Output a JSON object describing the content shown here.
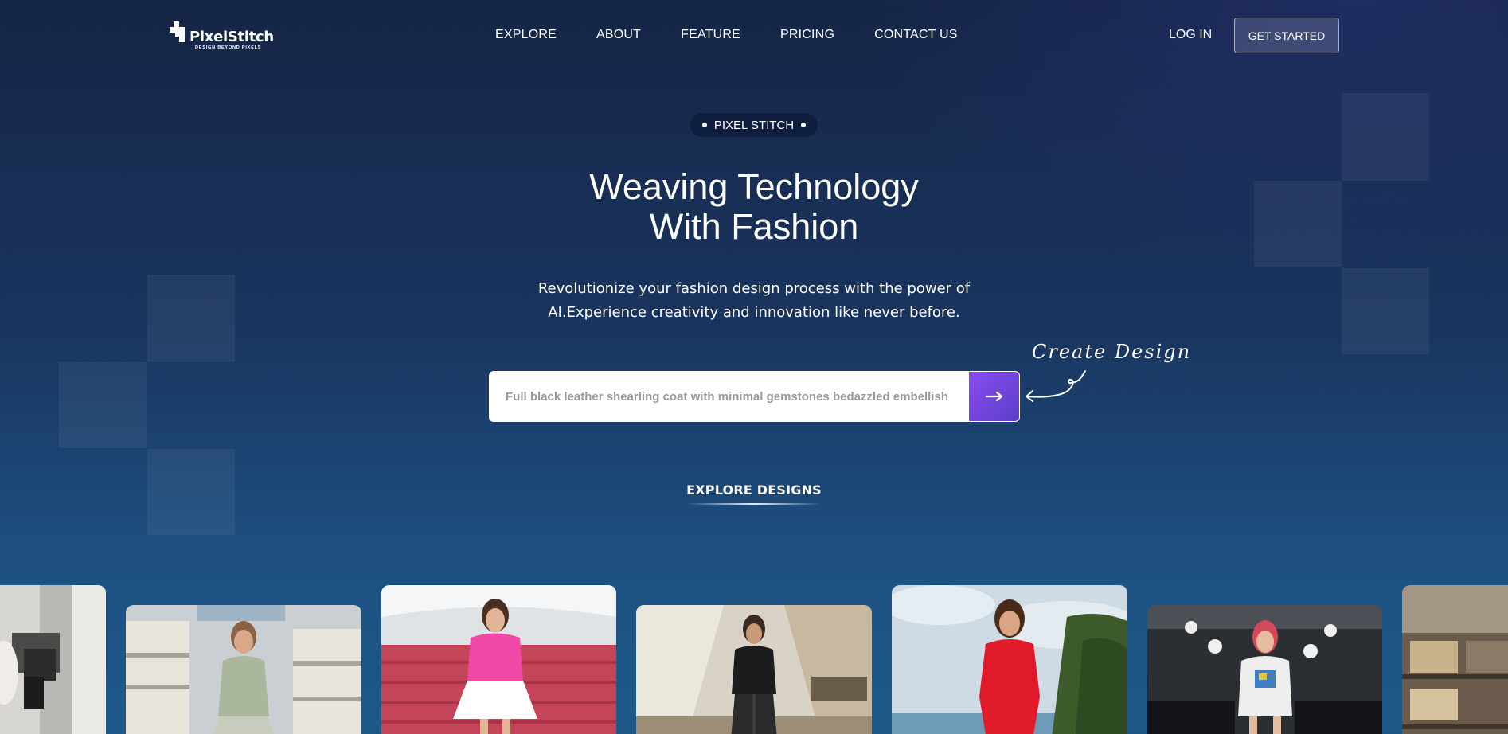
{
  "brand": {
    "name": "PixelStitch",
    "tagline": "DESIGN BEYOND PIXELS"
  },
  "nav": {
    "links": [
      "EXPLORE",
      "ABOUT",
      "FEATURE",
      "PRICING",
      "CONTACT US"
    ],
    "login": "LOG IN",
    "get_started": "GET STARTED"
  },
  "hero": {
    "badge": "PIXEL STITCH",
    "title_line1": "Weaving Technology",
    "title_line2": "With Fashion",
    "subtitle_line1": "Revolutionize your fashion design process with the power of",
    "subtitle_line2": "AI.Experience creativity and innovation like never before.",
    "search_placeholder": "Full black leather shearling coat with minimal gemstones bedazzled embellish",
    "submit_icon": "arrow-right-icon",
    "annotation": "Create Design"
  },
  "explore": {
    "label": "EXPLORE DESIGNS"
  },
  "gallery": {
    "cards": [
      {
        "name": "white-dress-mall",
        "outfit": "white-dress"
      },
      {
        "name": "sage-blouse-pleated-skirt",
        "outfit": "sage-green"
      },
      {
        "name": "pink-tee-white-skirt-stadium",
        "outfit": "pink-white"
      },
      {
        "name": "black-leather-outfit-mall",
        "outfit": "black-leather"
      },
      {
        "name": "red-dress-beach",
        "outfit": "red-dress"
      },
      {
        "name": "graphic-tee-runway",
        "outfit": "graphic-tee"
      },
      {
        "name": "mall-interior-partial",
        "outfit": "mall"
      }
    ]
  },
  "colors": {
    "accent": "#7b4ae8",
    "background": "#1a3560"
  }
}
